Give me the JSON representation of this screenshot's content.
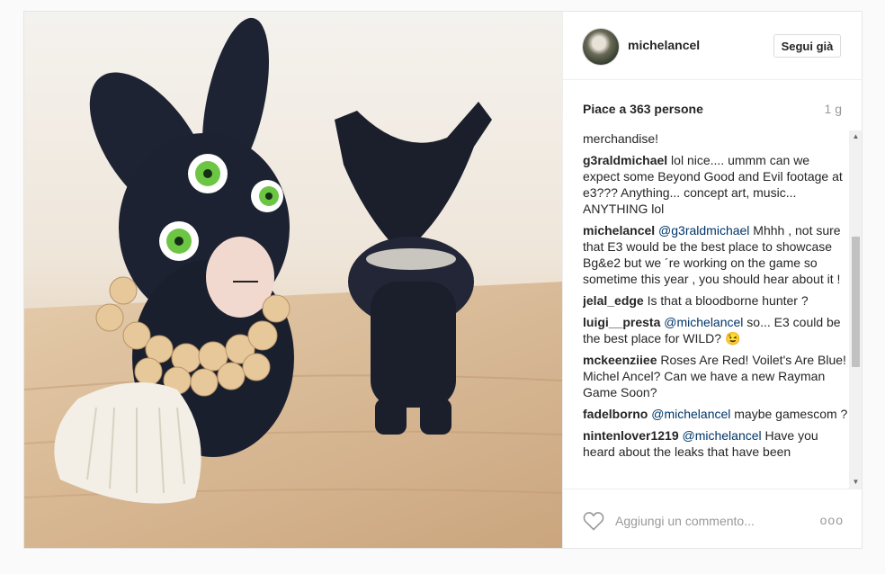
{
  "post": {
    "username": "michelancel",
    "follow_label": "Segui già",
    "likes_text": "Piace a 363 persone",
    "age": "1 g",
    "comment_placeholder": "Aggiungi un commento...",
    "more_label": "ooo"
  },
  "comments": [
    {
      "parts": [
        {
          "t": "merchandise!",
          "k": "text"
        }
      ]
    },
    {
      "parts": [
        {
          "t": "g3raldmichael",
          "k": "user"
        },
        {
          "t": " lol nice.... ummm can we expect some Beyond Good and Evil footage at e3??? Anything... concept art, music... ANYTHING lol",
          "k": "text"
        }
      ]
    },
    {
      "parts": [
        {
          "t": "michelancel",
          "k": "user"
        },
        {
          "t": " ",
          "k": "text"
        },
        {
          "t": "@g3raldmichael",
          "k": "mention"
        },
        {
          "t": " Mhhh , not sure that E3 would be the best place to showcase Bg&e2 but we ´re working on the game so sometime this year , you should hear about it !",
          "k": "text"
        }
      ]
    },
    {
      "parts": [
        {
          "t": "jelal_edge",
          "k": "user"
        },
        {
          "t": " Is that a bloodborne hunter ?",
          "k": "text"
        }
      ]
    },
    {
      "parts": [
        {
          "t": "luigi__presta",
          "k": "user"
        },
        {
          "t": " ",
          "k": "text"
        },
        {
          "t": "@michelancel",
          "k": "mention"
        },
        {
          "t": " so... E3 could be the best place for WILD? 😉",
          "k": "text"
        }
      ]
    },
    {
      "parts": [
        {
          "t": "mckeenziiee",
          "k": "user"
        },
        {
          "t": " Roses Are Red! Voilet's Are Blue! Michel Ancel? Can we have a new Rayman Game Soon?",
          "k": "text"
        }
      ]
    },
    {
      "parts": [
        {
          "t": "fadelborno",
          "k": "user"
        },
        {
          "t": " ",
          "k": "text"
        },
        {
          "t": "@michelancel",
          "k": "mention"
        },
        {
          "t": " maybe gamescom ?",
          "k": "text"
        }
      ]
    },
    {
      "parts": [
        {
          "t": "nintenlover1219",
          "k": "user"
        },
        {
          "t": " ",
          "k": "text"
        },
        {
          "t": "@michelancel",
          "k": "mention"
        },
        {
          "t": " Have you heard about the leaks that have been",
          "k": "text"
        }
      ]
    }
  ],
  "icons": {
    "heart": "heart-icon",
    "scroll_up": "▲",
    "scroll_down": "▼"
  },
  "colors": {
    "mention": "#003569",
    "meta_gray": "#999999",
    "border": "#efefef"
  }
}
